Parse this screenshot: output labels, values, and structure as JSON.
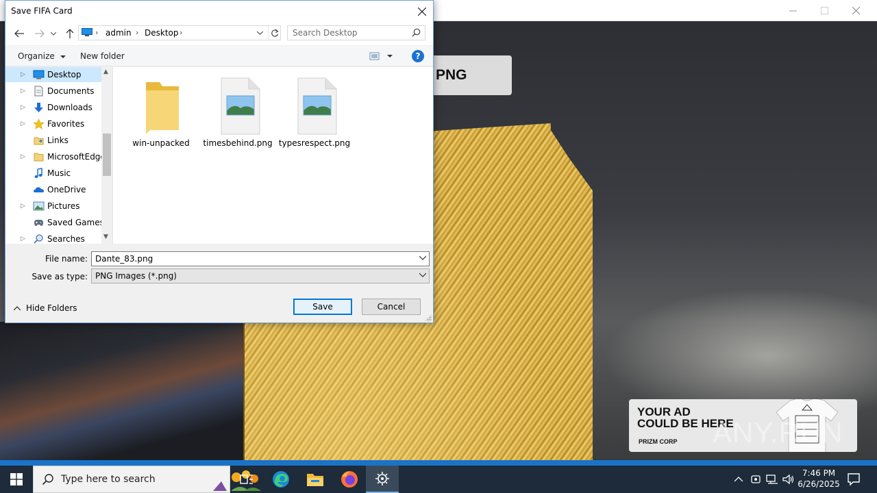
{
  "background_app": {
    "banner_text": "PNG",
    "ad": {
      "line1": "YOUR AD",
      "line2": "COULD BE HERE",
      "corp": "PRIZM CORP"
    },
    "watermark": "ANY.RUN",
    "window_controls": [
      "minimize-icon",
      "maximize-icon",
      "close-icon"
    ]
  },
  "dialog": {
    "title": "Save FIFA Card",
    "address": {
      "crumbs": [
        "admin",
        "Desktop"
      ]
    },
    "search": {
      "placeholder": "Search Desktop"
    },
    "toolbar": {
      "organize": "Organize",
      "new_folder": "New folder",
      "help": "?"
    },
    "tree": [
      {
        "label": "Desktop",
        "icon": "desktop-icon",
        "expandable": true,
        "selected": true
      },
      {
        "label": "Documents",
        "icon": "documents-icon",
        "expandable": true
      },
      {
        "label": "Downloads",
        "icon": "downloads-icon",
        "expandable": true
      },
      {
        "label": "Favorites",
        "icon": "favorites-icon",
        "expandable": true
      },
      {
        "label": "Links",
        "icon": "links-icon",
        "expandable": false
      },
      {
        "label": "MicrosoftEdge",
        "icon": "folder-icon",
        "expandable": true
      },
      {
        "label": "Music",
        "icon": "music-icon",
        "expandable": false
      },
      {
        "label": "OneDrive",
        "icon": "onedrive-icon",
        "expandable": false
      },
      {
        "label": "Pictures",
        "icon": "pictures-icon",
        "expandable": true
      },
      {
        "label": "Saved Games",
        "icon": "saved-games-icon",
        "expandable": false
      },
      {
        "label": "Searches",
        "icon": "searches-icon",
        "expandable": true
      }
    ],
    "files": [
      {
        "name": "win-unpacked",
        "type": "folder"
      },
      {
        "name": "timesbehind.png",
        "type": "image"
      },
      {
        "name": "typesrespect.png",
        "type": "image"
      }
    ],
    "file_name_label": "File name:",
    "file_name_value": "Dante_83.png",
    "save_type_label": "Save as type:",
    "save_type_value": "PNG Images (*.png)",
    "hide_folders": "Hide Folders",
    "save": "Save",
    "cancel": "Cancel"
  },
  "taskbar": {
    "search_placeholder": "Type here to search",
    "apps": [
      "task-view-icon",
      "edge-icon",
      "file-explorer-icon",
      "firefox-icon",
      "app-gear-icon"
    ],
    "clock_time": "7:46 PM",
    "clock_date": "6/26/2025"
  },
  "colors": {
    "accent": "#0078d7",
    "taskbar": "#1d2b3a",
    "selection": "#cce8ff"
  }
}
